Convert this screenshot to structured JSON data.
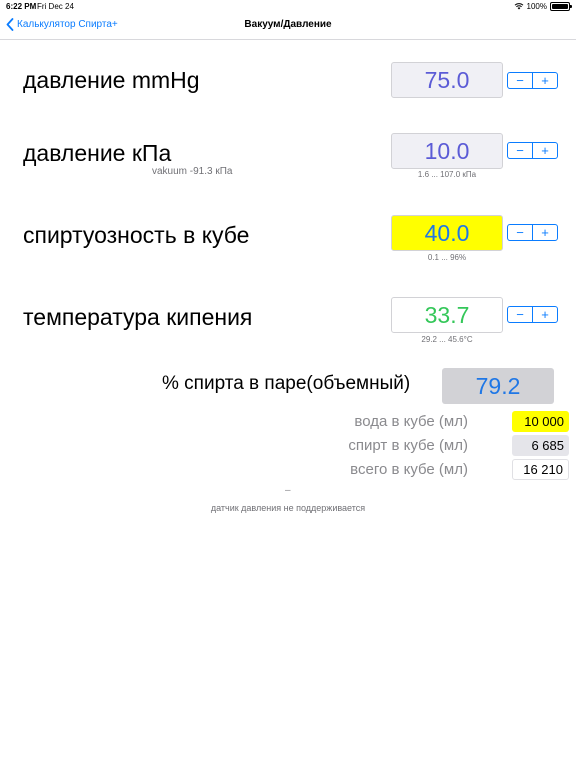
{
  "status_bar": {
    "time": "6:22 PM",
    "date": "Fri Dec 24",
    "battery": "100%"
  },
  "nav": {
    "back_label": "Калькулятор Спирта+",
    "title": "Вакуум/Давление"
  },
  "rows": [
    {
      "label": "давление mmHg",
      "value": "75.0",
      "value_color": "#5b5bd6",
      "box_color": "#f0f0f5",
      "note": ""
    },
    {
      "label": "давление кПа",
      "value": "10.0",
      "value_color": "#5b5bd6",
      "box_color": "#f0f0f5",
      "sub": "vakuum -91.3 кПа",
      "note": "1.6 ... 107.0 кПа"
    },
    {
      "label": "спиртуозность в кубе",
      "value": "40.0",
      "value_color": "#1f77e6",
      "box_color": "#ffff00",
      "note": "0.1 ... 96%"
    },
    {
      "label": "температура кипения",
      "value": "33.7",
      "value_color": "#34c759",
      "box_color": "#ffffff",
      "note": "29.2 ... 45.6°C"
    }
  ],
  "stepper": {
    "minus": "−",
    "plus": "+"
  },
  "vapor": {
    "label": "% спирта в паре(объемный)",
    "value": "79.2"
  },
  "volumes": [
    {
      "label": "вода в кубе (мл)",
      "value": "10 000",
      "box_color": "#ffff00"
    },
    {
      "label": "спирт в кубе (мл)",
      "value": "6 685",
      "box_color": "#e5e5ea"
    },
    {
      "label": "всего в кубе (мл)",
      "value": "16 210",
      "box_color": "#ffffff"
    }
  ],
  "sensor": {
    "dash": "–",
    "note": "датчик давления не поддерживается"
  },
  "colors": {
    "accent": "#0a7cff"
  }
}
